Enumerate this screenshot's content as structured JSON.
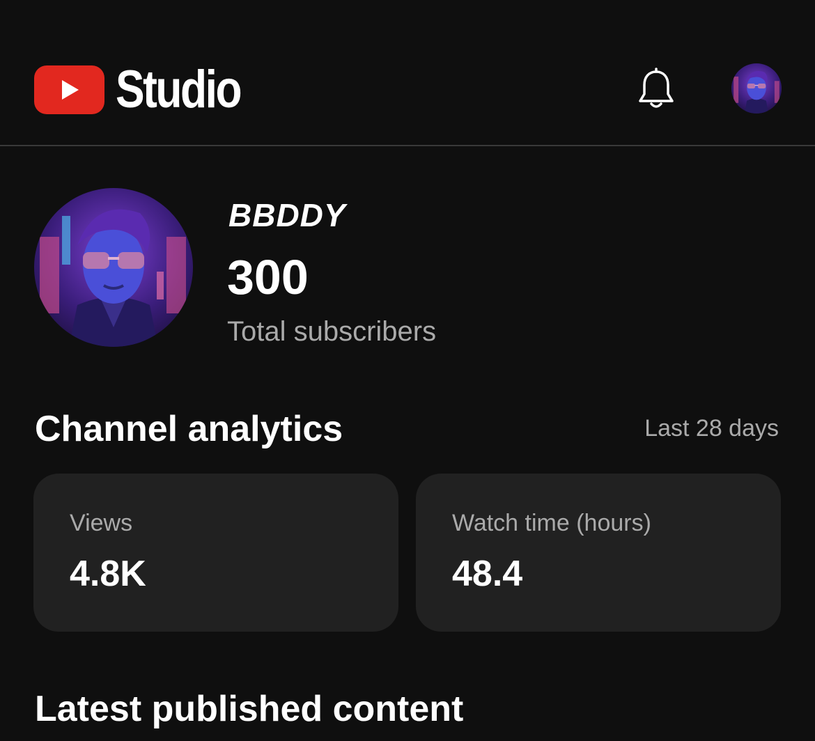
{
  "app": {
    "logo_text": "Studio",
    "brand_color": "#e2281f"
  },
  "header": {
    "notification_icon": "bell-icon",
    "account_icon": "avatar"
  },
  "channel": {
    "name": "BBDDY",
    "subscriber_count": "300",
    "subscriber_label": "Total subscribers"
  },
  "analytics": {
    "title": "Channel analytics",
    "period": "Last 28 days",
    "cards": [
      {
        "label": "Views",
        "value": "4.8K"
      },
      {
        "label": "Watch time (hours)",
        "value": "48.4"
      }
    ]
  },
  "latest": {
    "title": "Latest published content"
  }
}
